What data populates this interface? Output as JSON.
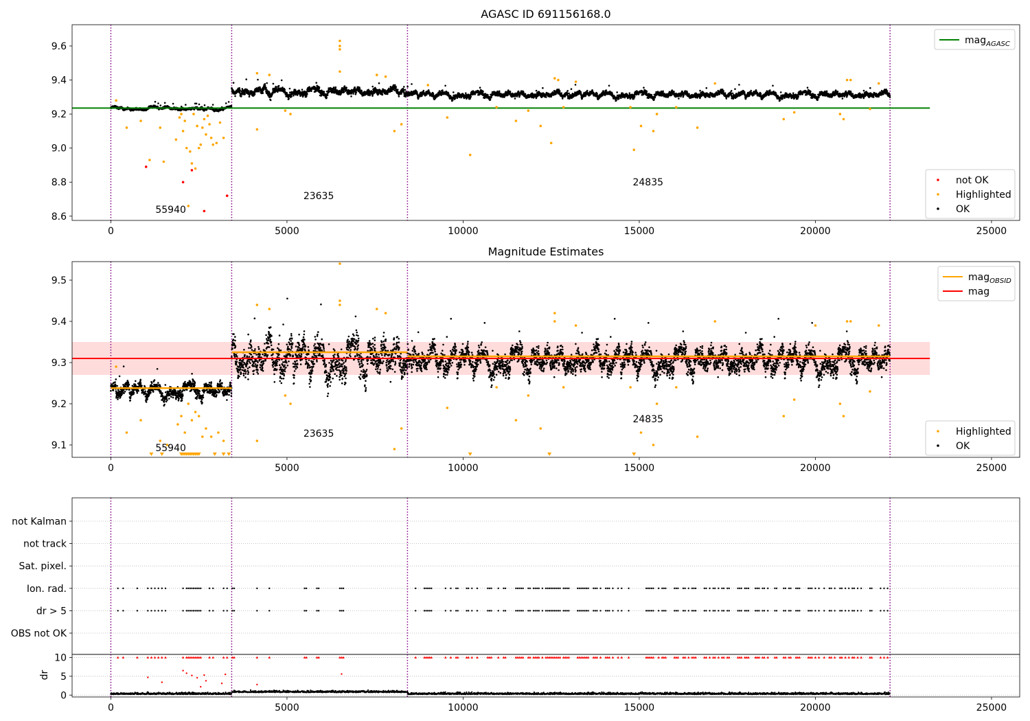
{
  "figure": {
    "vlines_x": [
      0,
      3430,
      8420,
      22120
    ],
    "colors": {
      "ok": "#000000",
      "highlighted": "#ffa500",
      "not_ok": "#ff0000",
      "agasc_line": "#008000",
      "mag_line": "#ff0000",
      "mag_band": "#ffc0c0",
      "obsid_line": "#ffa500",
      "vline": "#800080",
      "grid": "#b0b0b0",
      "dr_marks": "#ff0000"
    }
  },
  "chart_data": [
    {
      "type": "scatter",
      "title": "AGASC ID 691156168.0",
      "xlim": [
        -1100,
        25800
      ],
      "ylim": [
        8.575,
        9.725
      ],
      "x_ticks": [
        0,
        5000,
        10000,
        15000,
        20000,
        25000
      ],
      "y_ticks": [
        8.6,
        8.8,
        9.0,
        9.2,
        9.4,
        9.6
      ],
      "hline": {
        "name": "mag",
        "sub": "AGASC",
        "y": 9.235,
        "x_range": [
          -1100,
          23250
        ]
      },
      "segments": [
        {
          "obsid": "55940",
          "x": [
            0,
            3430
          ],
          "base": 9.235,
          "noise": 0.01,
          "label_x": 1700,
          "label_y": 8.62
        },
        {
          "obsid": "23635",
          "x": [
            3430,
            8420
          ],
          "base": 9.34,
          "noise": 0.025,
          "label_x": 5900,
          "label_y": 8.7
        },
        {
          "obsid": "24835",
          "x": [
            8420,
            22120
          ],
          "base": 9.32,
          "noise": 0.02,
          "label_x": 15250,
          "label_y": 8.78
        }
      ],
      "highlighted_points": [
        [
          150,
          9.28
        ],
        [
          450,
          9.12
        ],
        [
          850,
          9.16
        ],
        [
          1400,
          9.12
        ],
        [
          1850,
          9.05
        ],
        [
          1950,
          9.18
        ],
        [
          2050,
          9.1
        ],
        [
          2150,
          9.0
        ],
        [
          2250,
          8.98
        ],
        [
          2350,
          9.2
        ],
        [
          2450,
          9.13
        ],
        [
          2550,
          9.02
        ],
        [
          2650,
          9.17
        ],
        [
          2750,
          9.19
        ],
        [
          2850,
          9.06
        ],
        [
          3000,
          9.03
        ],
        [
          3100,
          9.15
        ],
        [
          3200,
          9.06
        ],
        [
          2000,
          9.2
        ],
        [
          2100,
          9.16
        ],
        [
          2200,
          8.66
        ],
        [
          2300,
          8.91
        ],
        [
          2400,
          8.88
        ],
        [
          2500,
          9.0
        ],
        [
          2600,
          9.12
        ],
        [
          2700,
          9.08
        ],
        [
          2800,
          9.14
        ],
        [
          2900,
          9.02
        ],
        [
          1500,
          8.92
        ],
        [
          1100,
          8.93
        ],
        [
          4150,
          9.44
        ],
        [
          4150,
          9.11
        ],
        [
          4500,
          9.43
        ],
        [
          4950,
          9.22
        ],
        [
          5100,
          9.2
        ],
        [
          6500,
          9.63
        ],
        [
          6500,
          9.6
        ],
        [
          6500,
          9.58
        ],
        [
          6500,
          9.45
        ],
        [
          7550,
          9.43
        ],
        [
          7800,
          9.42
        ],
        [
          8050,
          9.1
        ],
        [
          8250,
          9.14
        ],
        [
          9000,
          9.37
        ],
        [
          9550,
          9.18
        ],
        [
          10200,
          8.96
        ],
        [
          10950,
          9.24
        ],
        [
          11500,
          9.16
        ],
        [
          11850,
          9.22
        ],
        [
          12200,
          9.13
        ],
        [
          12500,
          9.03
        ],
        [
          12600,
          9.41
        ],
        [
          12700,
          9.4
        ],
        [
          12850,
          9.24
        ],
        [
          13200,
          9.39
        ],
        [
          14750,
          9.24
        ],
        [
          14850,
          8.99
        ],
        [
          15050,
          9.13
        ],
        [
          15400,
          9.1
        ],
        [
          15500,
          9.2
        ],
        [
          16050,
          9.24
        ],
        [
          16650,
          9.12
        ],
        [
          17150,
          9.38
        ],
        [
          19100,
          9.17
        ],
        [
          19400,
          9.21
        ],
        [
          20700,
          9.2
        ],
        [
          20800,
          9.17
        ],
        [
          20900,
          9.4
        ],
        [
          21000,
          9.4
        ],
        [
          21550,
          9.23
        ],
        [
          21800,
          9.38
        ]
      ],
      "not_ok_points": [
        [
          1000,
          8.89
        ],
        [
          2050,
          8.8
        ],
        [
          2300,
          8.87
        ],
        [
          2650,
          8.63
        ],
        [
          3300,
          8.72
        ]
      ],
      "legends": [
        {
          "items": [
            {
              "label": "mag",
              "sub": "AGASC",
              "kind": "line",
              "color": "#008000"
            }
          ]
        },
        {
          "items": [
            {
              "label": "not OK",
              "kind": "dot",
              "color": "#ff0000"
            },
            {
              "label": "Highlighted",
              "kind": "dot",
              "color": "#ffa500"
            },
            {
              "label": "OK",
              "kind": "dot",
              "color": "#000000"
            }
          ]
        }
      ]
    },
    {
      "type": "scatter",
      "title": "Magnitude Estimates",
      "xlim": [
        -1100,
        25800
      ],
      "ylim": [
        9.07,
        9.545
      ],
      "x_ticks": [
        0,
        5000,
        10000,
        15000,
        20000,
        25000
      ],
      "y_ticks": [
        9.1,
        9.2,
        9.3,
        9.4,
        9.5
      ],
      "mag_line": {
        "name": "mag",
        "y": 9.31,
        "band": [
          9.27,
          9.35
        ],
        "x_range": [
          -1100,
          23250
        ]
      },
      "obsid_lines": [
        {
          "x": [
            0,
            3430
          ],
          "y": 9.238
        },
        {
          "x": [
            3430,
            8420
          ],
          "y": 9.325
        },
        {
          "x": [
            8420,
            22120
          ],
          "y": 9.315
        }
      ],
      "segments": [
        {
          "obsid": "55940",
          "x": [
            0,
            3430
          ],
          "base": 9.238,
          "noise": 0.02,
          "label_x": 1700,
          "label_y": 9.085
        },
        {
          "obsid": "23635",
          "x": [
            3430,
            8420
          ],
          "base": 9.325,
          "noise": 0.05,
          "label_x": 5900,
          "label_y": 9.12
        },
        {
          "obsid": "24835",
          "x": [
            8420,
            22120
          ],
          "base": 9.315,
          "noise": 0.035,
          "label_x": 15250,
          "label_y": 9.155
        }
      ],
      "highlighted_points": [
        [
          150,
          9.29
        ],
        [
          450,
          9.13
        ],
        [
          850,
          9.16
        ],
        [
          1400,
          9.11
        ],
        [
          1600,
          9.1
        ],
        [
          1900,
          9.15
        ],
        [
          2000,
          9.17
        ],
        [
          2100,
          9.13
        ],
        [
          2200,
          9.2
        ],
        [
          2300,
          9.16
        ],
        [
          2400,
          9.18
        ],
        [
          2500,
          9.17
        ],
        [
          2600,
          9.12
        ],
        [
          2700,
          9.14
        ],
        [
          2850,
          9.12
        ],
        [
          3050,
          9.13
        ],
        [
          3200,
          9.11
        ],
        [
          4150,
          9.44
        ],
        [
          4150,
          9.11
        ],
        [
          4500,
          9.43
        ],
        [
          4950,
          9.22
        ],
        [
          5100,
          9.2
        ],
        [
          6500,
          9.54
        ],
        [
          6500,
          9.45
        ],
        [
          6500,
          9.44
        ],
        [
          7550,
          9.43
        ],
        [
          7800,
          9.42
        ],
        [
          8050,
          9.09
        ],
        [
          8250,
          9.14
        ],
        [
          9550,
          9.19
        ],
        [
          10950,
          9.24
        ],
        [
          11500,
          9.16
        ],
        [
          11850,
          9.22
        ],
        [
          12200,
          9.14
        ],
        [
          12600,
          9.42
        ],
        [
          12600,
          9.4
        ],
        [
          12850,
          9.24
        ],
        [
          13200,
          9.39
        ],
        [
          14750,
          9.24
        ],
        [
          15050,
          9.13
        ],
        [
          15400,
          9.1
        ],
        [
          15500,
          9.2
        ],
        [
          16050,
          9.24
        ],
        [
          16650,
          9.12
        ],
        [
          17150,
          9.4
        ],
        [
          19100,
          9.17
        ],
        [
          19400,
          9.21
        ],
        [
          20000,
          9.39
        ],
        [
          20700,
          9.2
        ],
        [
          20800,
          9.17
        ],
        [
          20900,
          9.4
        ],
        [
          21000,
          9.4
        ],
        [
          21550,
          9.23
        ],
        [
          21800,
          9.39
        ]
      ],
      "highlighted_triangles": [
        1150,
        1450,
        2000,
        2050,
        2100,
        2150,
        2200,
        2250,
        2300,
        2350,
        2400,
        2450,
        2500,
        2950,
        3200,
        3350,
        10200,
        12450,
        14850
      ],
      "legends": [
        {
          "items": [
            {
              "label": "mag",
              "sub": "OBSID",
              "kind": "line",
              "color": "#ffa500"
            },
            {
              "label": "mag",
              "kind": "line",
              "color": "#ff0000"
            }
          ]
        },
        {
          "items": [
            {
              "label": "Highlighted",
              "kind": "dot",
              "color": "#ffa500"
            },
            {
              "label": "OK",
              "kind": "dot",
              "color": "#000000"
            }
          ]
        }
      ]
    },
    {
      "type": "scatter",
      "xlim": [
        -1100,
        25800
      ],
      "categories": [
        "not Kalman",
        "not track",
        "Sat. pixel.",
        "Ion. rad.",
        "dr > 5",
        "OBS not OK"
      ],
      "flag_x": [
        200,
        350,
        750,
        1050,
        1150,
        1250,
        1350,
        1450,
        1550,
        2050,
        2150,
        2200,
        2250,
        2300,
        2350,
        2400,
        2450,
        2500,
        2550,
        2800,
        2900,
        3200,
        3300,
        3450,
        3500,
        4150,
        4500,
        5500,
        5550,
        5850,
        5900,
        6500,
        6550,
        6600,
        8650,
        8900,
        8950,
        9000,
        9050,
        9100,
        9500,
        9650,
        9800,
        9850,
        10100,
        10150,
        10250,
        10400,
        10700,
        10750,
        10800,
        11000,
        11150,
        11200,
        11500,
        11550,
        11600,
        11650,
        11700,
        11850,
        11900,
        12000,
        12050,
        12100,
        12150,
        12250,
        12350,
        12400,
        12450,
        12500,
        12550,
        12600,
        12650,
        12700,
        12750,
        12850,
        12900,
        12950,
        13000,
        13250,
        13300,
        13350,
        13400,
        13450,
        13500,
        13550,
        13700,
        13750,
        13800,
        13900,
        14050,
        14100,
        14150,
        14250,
        14400,
        14500,
        14700,
        15200,
        15250,
        15300,
        15350,
        15400,
        15550,
        15650,
        15700,
        15750,
        16000,
        16050,
        16100,
        16250,
        16300,
        16400,
        16500,
        16550,
        16600,
        16850,
        16900,
        17000,
        17100,
        17150,
        17250,
        17350,
        17400,
        17500,
        17550,
        17800,
        17850,
        17900,
        18000,
        18050,
        18100,
        18300,
        18350,
        18400,
        18500,
        18550,
        18650,
        18850,
        18900,
        19100,
        19150,
        19250,
        19300,
        19450,
        19500,
        19550,
        19800,
        19850,
        19900,
        20000,
        20100,
        20250,
        20400,
        20450,
        20550,
        20700,
        20750,
        20850,
        20950,
        21050,
        21100,
        21200,
        21300,
        21550,
        21600,
        21850,
        21950,
        22050
      ],
      "dr": {
        "ylabel": "dr",
        "ylim": [
          -0.5,
          10.8
        ],
        "y_ticks": [
          0,
          5,
          10
        ],
        "clip_value": 10,
        "outliers": [
          [
            2050,
            6.5
          ],
          [
            2150,
            5.8
          ],
          [
            2300,
            5.2
          ],
          [
            2450,
            4.6
          ],
          [
            2650,
            5.3
          ],
          [
            3250,
            5.5
          ],
          [
            6550,
            5.6
          ],
          [
            1450,
            3.4
          ],
          [
            1050,
            4.7
          ],
          [
            3150,
            3.1
          ],
          [
            4150,
            2.8
          ],
          [
            2550,
            2.2
          ],
          [
            2700,
            3.8
          ]
        ]
      }
    }
  ]
}
